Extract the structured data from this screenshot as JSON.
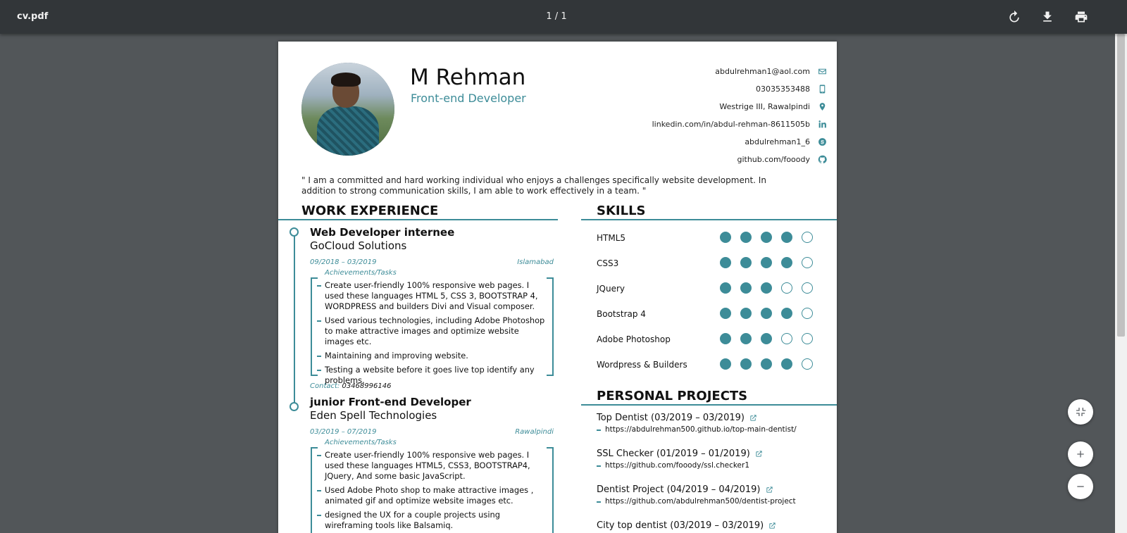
{
  "toolbar": {
    "title": "cv.pdf",
    "page_indicator": "1 / 1",
    "buttons": [
      "rotate-icon",
      "download-icon",
      "print-icon"
    ]
  },
  "cv": {
    "name": "M Rehman",
    "role": "Front-end Developer",
    "contacts": [
      {
        "text": "abdulrehman1@aol.com",
        "icon": "email-icon"
      },
      {
        "text": "03035353488",
        "icon": "phone-icon"
      },
      {
        "text": "Westrige III, Rawalpindi",
        "icon": "location-icon"
      },
      {
        "text": "linkedin.com/in/abdul-rehman-8611505b",
        "icon": "linkedin-icon"
      },
      {
        "text": "abdulrehman1_6",
        "icon": "skype-icon"
      },
      {
        "text": "github.com/fooody",
        "icon": "github-icon"
      }
    ],
    "summary": "\" I am a committed and hard working individual who enjoys a challenges specifically website development. In addition to strong communication skills, I am able to work effectively in a team. \"",
    "work_title": "WORK EXPERIENCE",
    "skills_title": "SKILLS",
    "projects_title": "PERSONAL PROJECTS",
    "jobs": [
      {
        "title": "Web Developer internee",
        "company": "GoCloud Solutions",
        "dates": "09/2018 – 03/2019",
        "place": "Islamabad",
        "ach_label": "Achievements/Tasks",
        "tasks": [
          "Create user-friendly 100% responsive web pages. I used these languages HTML 5, CSS 3, BOOTSTRAP 4, WORDPRESS and builders Divi and Visual composer.",
          "Used various technologies, including Adobe Photoshop to make attractive images and optimize website images etc.",
          "Maintaining and improving website.",
          "Testing a website before it goes live top identify any problems."
        ],
        "contact_label": "Contact:",
        "contact_value": "03468996146"
      },
      {
        "title": "junior Front-end Developer",
        "company": "Eden Spell Technologies",
        "dates": "03/2019 – 07/2019",
        "place": "Rawalpindi",
        "ach_label": "Achievements/Tasks",
        "tasks": [
          "Create user-friendly 100% responsive web pages. I used these languages HTML5, CSS3, BOOTSTRAP4, JQuery, And some basic JavaScript.",
          "Used Adobe Photo shop to make attractive images , animated gif and optimize website images etc.",
          "designed the UX for a couple projects using wireframing tools like Balsamiq."
        ]
      }
    ],
    "skills": [
      {
        "name": "HTML5",
        "level": 4,
        "max": 5
      },
      {
        "name": "CSS3",
        "level": 4,
        "max": 5
      },
      {
        "name": "JQuery",
        "level": 3,
        "max": 5
      },
      {
        "name": "Bootstrap 4",
        "level": 4,
        "max": 5
      },
      {
        "name": "Adobe Photoshop",
        "level": 3,
        "max": 5
      },
      {
        "name": "Wordpress & Builders",
        "level": 4,
        "max": 5
      }
    ],
    "projects": [
      {
        "title": "Top Dentist (03/2019 – 03/2019)",
        "url": "https://abdulrehman500.github.io/top-main-dentist/"
      },
      {
        "title": "SSL Checker (01/2019 – 01/2019)",
        "url": "https://github.com/fooody/ssl.checker1"
      },
      {
        "title": "Dentist Project (04/2019 – 04/2019)",
        "url": "https://github.com/abdulrehman500/dentist-project"
      },
      {
        "title": "City top dentist (03/2019 – 03/2019)",
        "url": ""
      }
    ]
  },
  "zoom_controls": [
    "fit-page-icon",
    "zoom-in-icon",
    "zoom-out-icon"
  ],
  "colors": {
    "accent": "#3d8c98",
    "toolbar": "#323639",
    "viewer_bg": "#525659"
  }
}
